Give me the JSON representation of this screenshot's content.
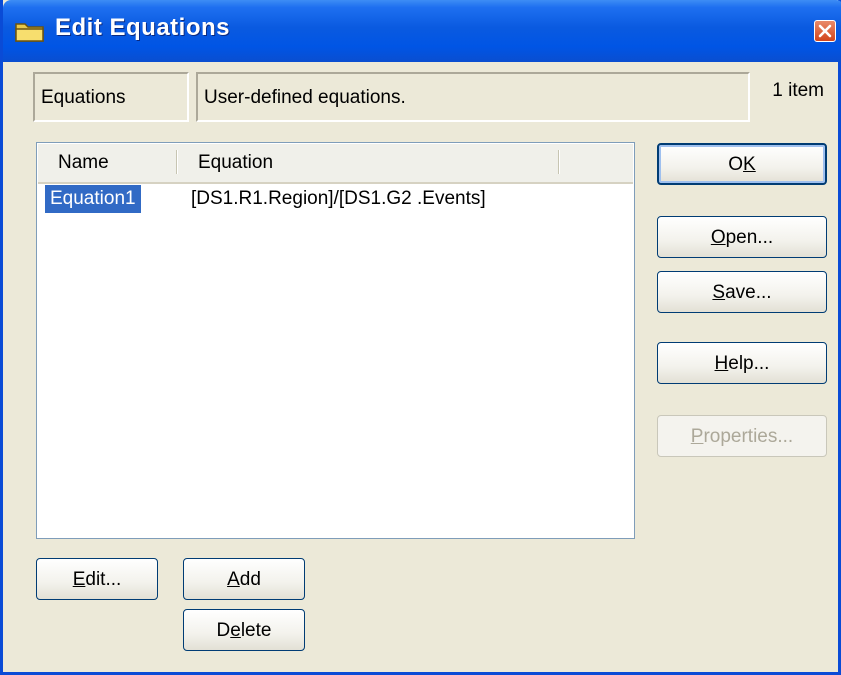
{
  "window": {
    "title": "Edit Equations"
  },
  "header": {
    "category": "Equations",
    "description": "User-defined equations.",
    "item_count": "1 item"
  },
  "list": {
    "columns": [
      "Name",
      "Equation"
    ],
    "rows": [
      {
        "name": "Equation1",
        "equation": "[DS1.R1.Region]/[DS1.G2 .Events]",
        "selected": true
      }
    ]
  },
  "buttons": {
    "ok": {
      "pre": "O",
      "key": "K",
      "post": ""
    },
    "open": {
      "pre": "",
      "key": "O",
      "post": "pen..."
    },
    "save": {
      "pre": "",
      "key": "S",
      "post": "ave..."
    },
    "help": {
      "pre": "",
      "key": "H",
      "post": "elp..."
    },
    "properties": {
      "pre": "",
      "key": "P",
      "post": "roperties..."
    },
    "edit": {
      "pre": "",
      "key": "E",
      "post": "dit..."
    },
    "add": {
      "pre": "",
      "key": "A",
      "post": "dd"
    },
    "delete": {
      "pre": "D",
      "key": "e",
      "post": "lete"
    }
  },
  "colors": {
    "titlebar": "#0055e5",
    "selection": "#316ac5",
    "close": "#d2451c"
  }
}
